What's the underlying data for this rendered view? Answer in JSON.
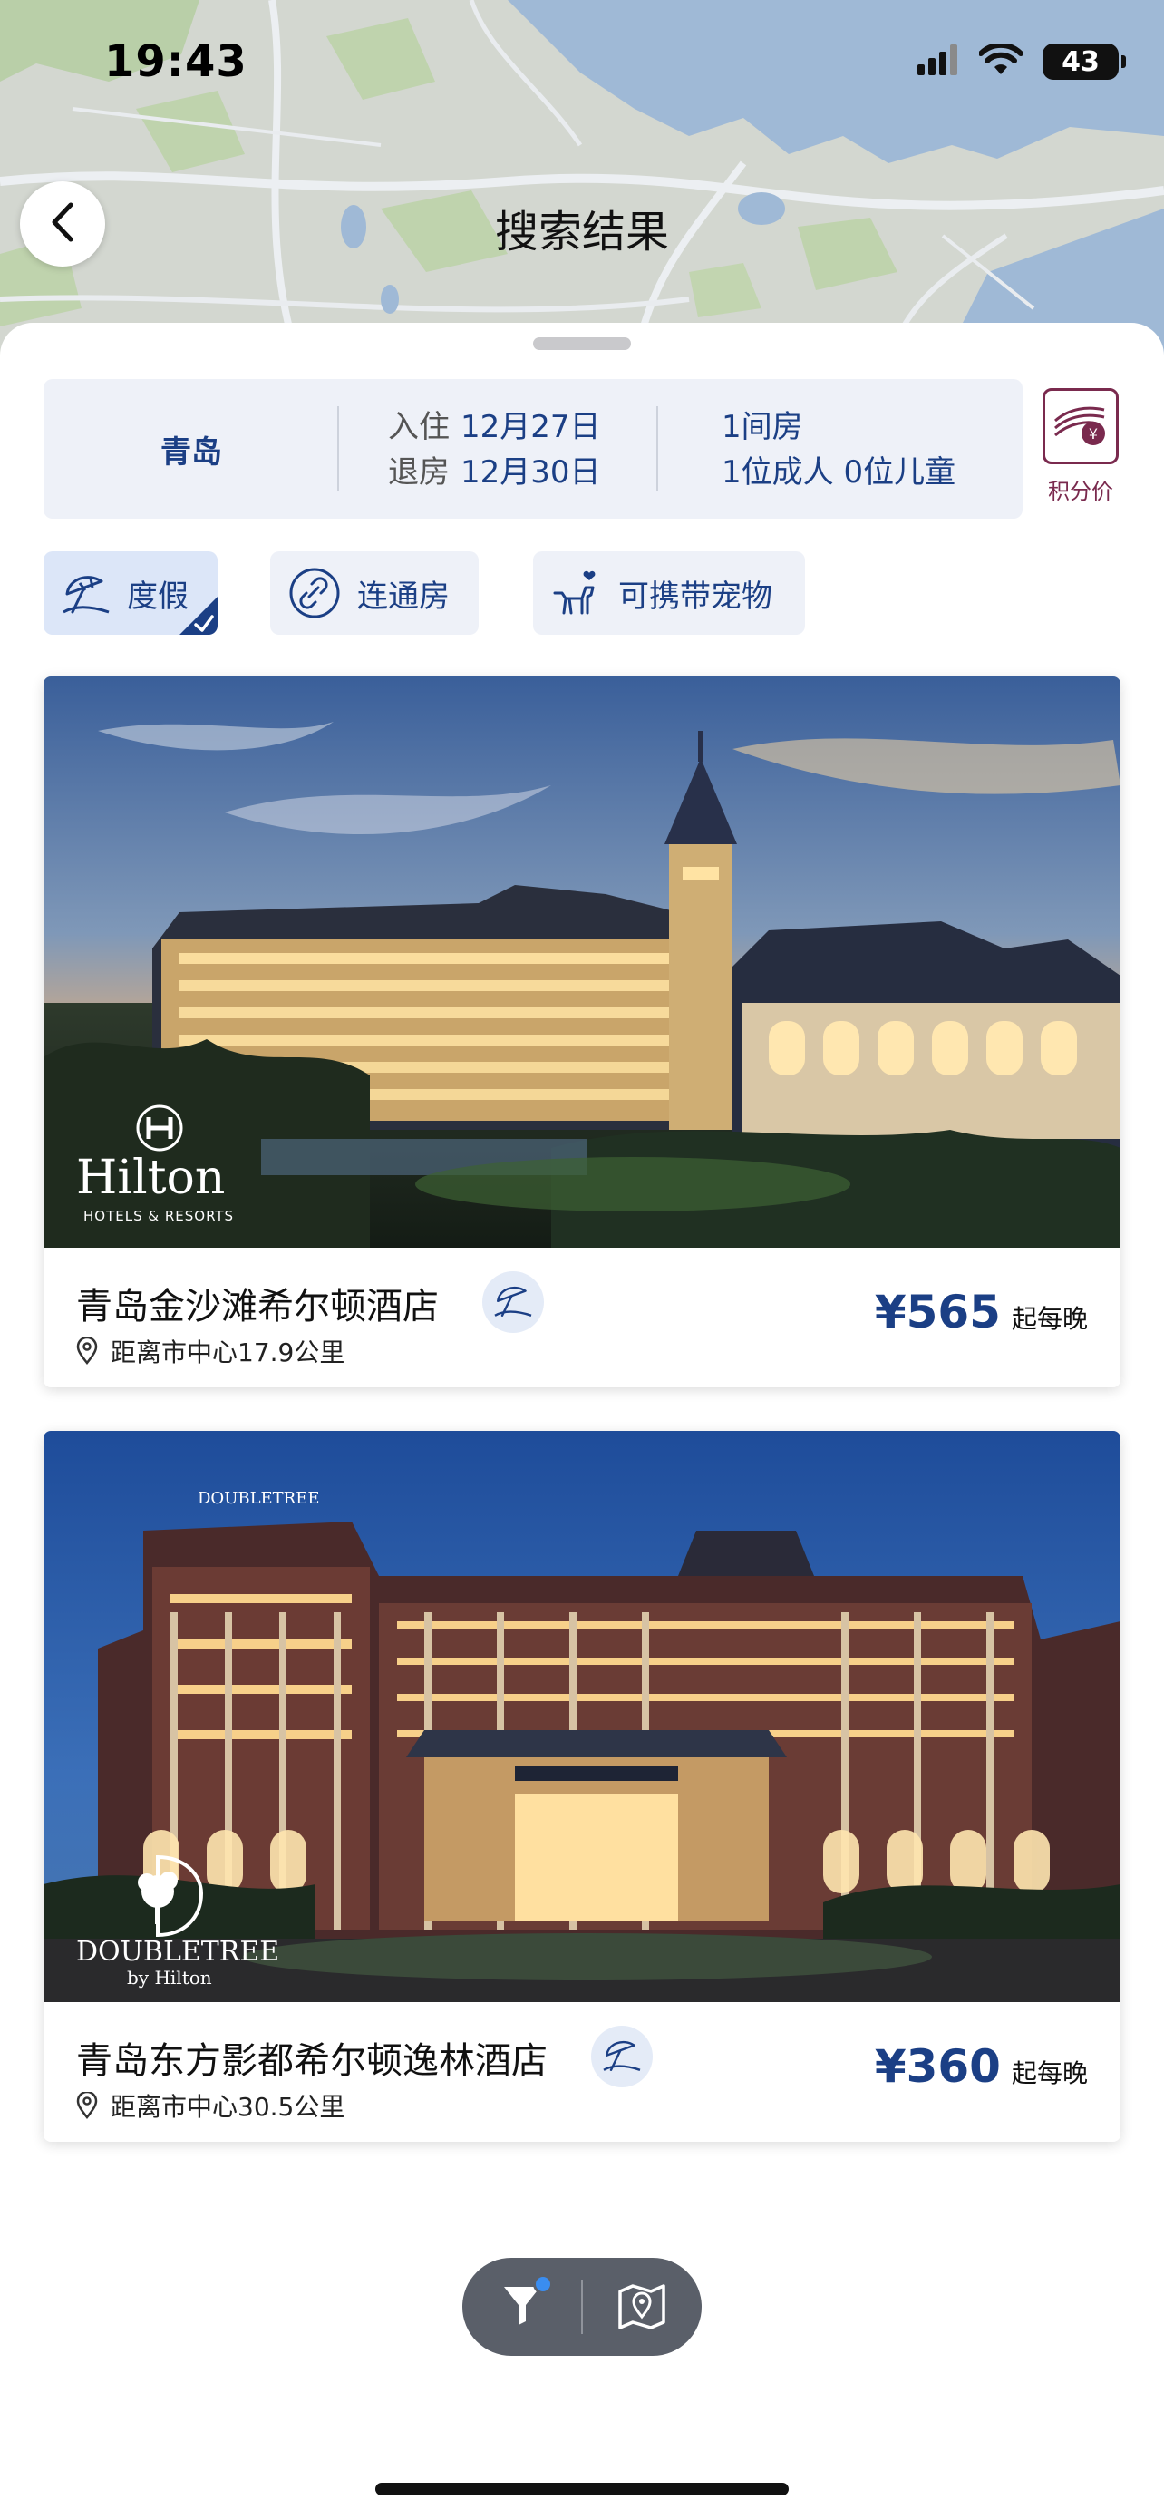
{
  "status_bar": {
    "time": "19:43",
    "battery": "43"
  },
  "header": {
    "title": "搜索结果"
  },
  "search_summary": {
    "city": "青岛",
    "check_in_label": "入住",
    "check_in_date": "12月27日",
    "check_out_label": "退房",
    "check_out_date": "12月30日",
    "rooms": "1间房",
    "guests": "1位成人 0位儿童"
  },
  "points_toggle": {
    "label": "积分价",
    "icon": "points-coins-icon"
  },
  "filters": [
    {
      "label": "度假",
      "icon": "beach-umbrella-icon",
      "selected": true
    },
    {
      "label": "连通房",
      "icon": "link-icon",
      "selected": false
    },
    {
      "label": "可携带宠物",
      "icon": "pet-icon",
      "selected": false
    }
  ],
  "hotels": [
    {
      "name": "青岛金沙滩希尔顿酒店",
      "distance": "距离市中心17.9公里",
      "price": "¥565",
      "price_unit": "起每晚",
      "brand": "Hilton",
      "brand_sub": "HOTELS & RESORTS"
    },
    {
      "name": "青岛东方影都希尔顿逸林酒店",
      "distance": "距离市中心30.5公里",
      "price": "¥360",
      "price_unit": "起每晚",
      "brand": "DOUBLETREE",
      "brand_sub": "by Hilton"
    }
  ],
  "toolbar": {
    "filter_icon": "filter-icon",
    "map_icon": "map-pin-icon",
    "filter_active": true
  },
  "colors": {
    "brand_blue": "#1b3f85",
    "points_maroon": "#7a2a4e",
    "chip_bg": "#eef1f8"
  }
}
